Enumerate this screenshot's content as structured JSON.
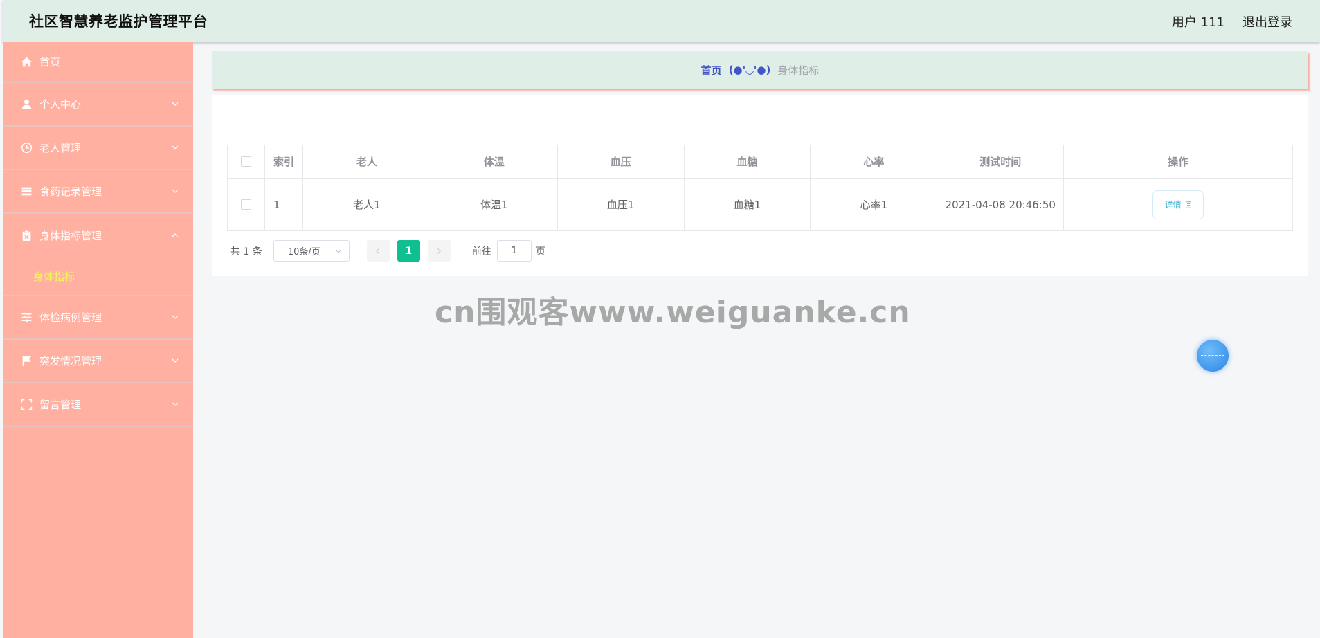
{
  "header": {
    "title": "社区智慧养老监护管理平台",
    "user": "用户 111",
    "logout": "退出登录"
  },
  "sidebar": {
    "items": [
      {
        "label": "首页",
        "icon": "home-icon"
      },
      {
        "label": "个人中心",
        "icon": "user-icon"
      },
      {
        "label": "老人管理",
        "icon": "clock-icon"
      },
      {
        "label": "食药记录管理",
        "icon": "list-icon"
      },
      {
        "label": "身体指标管理",
        "icon": "clipboard-icon",
        "expanded": true,
        "children": [
          {
            "label": "身体指标",
            "active": true
          }
        ]
      },
      {
        "label": "体检病例管理",
        "icon": "sliders-icon"
      },
      {
        "label": "突发情况管理",
        "icon": "flag-icon"
      },
      {
        "label": "留言管理",
        "icon": "fullscreen-icon"
      }
    ]
  },
  "breadcrumb": {
    "home": "首页",
    "separator": "(●'◡'●)",
    "current": "身体指标"
  },
  "table": {
    "columns": [
      "索引",
      "老人",
      "体温",
      "血压",
      "血糖",
      "心率",
      "测试时间",
      "操作"
    ],
    "rows": [
      {
        "index": "1",
        "elder": "老人1",
        "temperature": "体温1",
        "blood_pressure": "血压1",
        "blood_sugar": "血糖1",
        "heart_rate": "心率1",
        "test_time": "2021-04-08 20:46:50",
        "action": "详情"
      }
    ]
  },
  "pagination": {
    "total": "共 1 条",
    "page_size": "10条/页",
    "current_page": "1",
    "goto_label": "前往",
    "goto_value": "1",
    "goto_suffix": "页"
  },
  "watermark": "cn围观客www.weiguanke.cn",
  "colors": {
    "header_bg": "#dfeee6",
    "sidebar_bg": "#ffb0a0",
    "active_submenu": "#f1f75a",
    "pager_active": "#0fbf8f",
    "breadcrumb_link": "#4154c8"
  }
}
